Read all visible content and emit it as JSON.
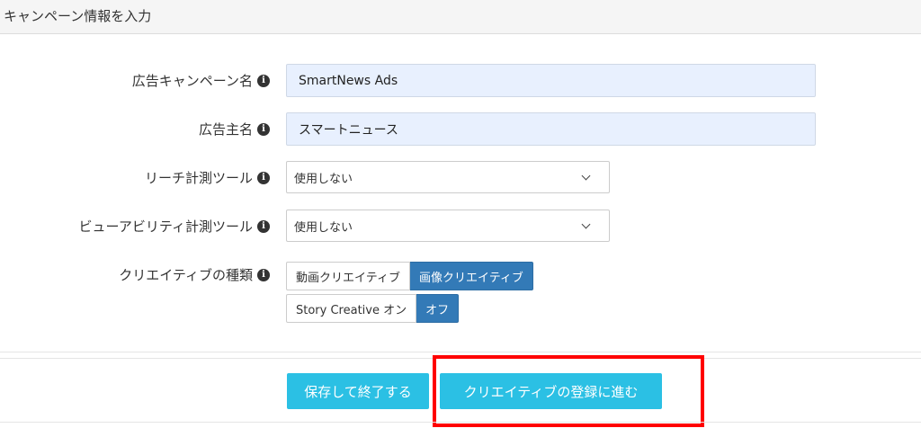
{
  "panel": {
    "title": "キャンペーン情報を入力"
  },
  "form": {
    "campaign_name": {
      "label": "広告キャンペーン名",
      "value": "SmartNews Ads"
    },
    "advertiser_name": {
      "label": "広告主名",
      "value": "スマートニュース"
    },
    "reach_tool": {
      "label": "リーチ計測ツール",
      "selected": "使用しない"
    },
    "viewability_tool": {
      "label": "ビューアビリティ計測ツール",
      "selected": "使用しない"
    },
    "creative_type": {
      "label": "クリエイティブの種類",
      "options": [
        "動画クリエイティブ",
        "画像クリエイティブ"
      ],
      "selected": "画像クリエイティブ"
    },
    "story_creative": {
      "options": [
        "Story Creative オン",
        "オフ"
      ],
      "selected": "オフ"
    }
  },
  "actions": {
    "save_label": "保存して終了する",
    "next_label": "クリエイティブの登録に進む"
  },
  "icons": {
    "info": "info-icon",
    "chevron": "chevron-down-icon"
  },
  "colors": {
    "accent_button": "#2bc0e4",
    "active_segment": "#337ab7",
    "input_bg": "#e8f0fe",
    "highlight": "#ff0000"
  }
}
